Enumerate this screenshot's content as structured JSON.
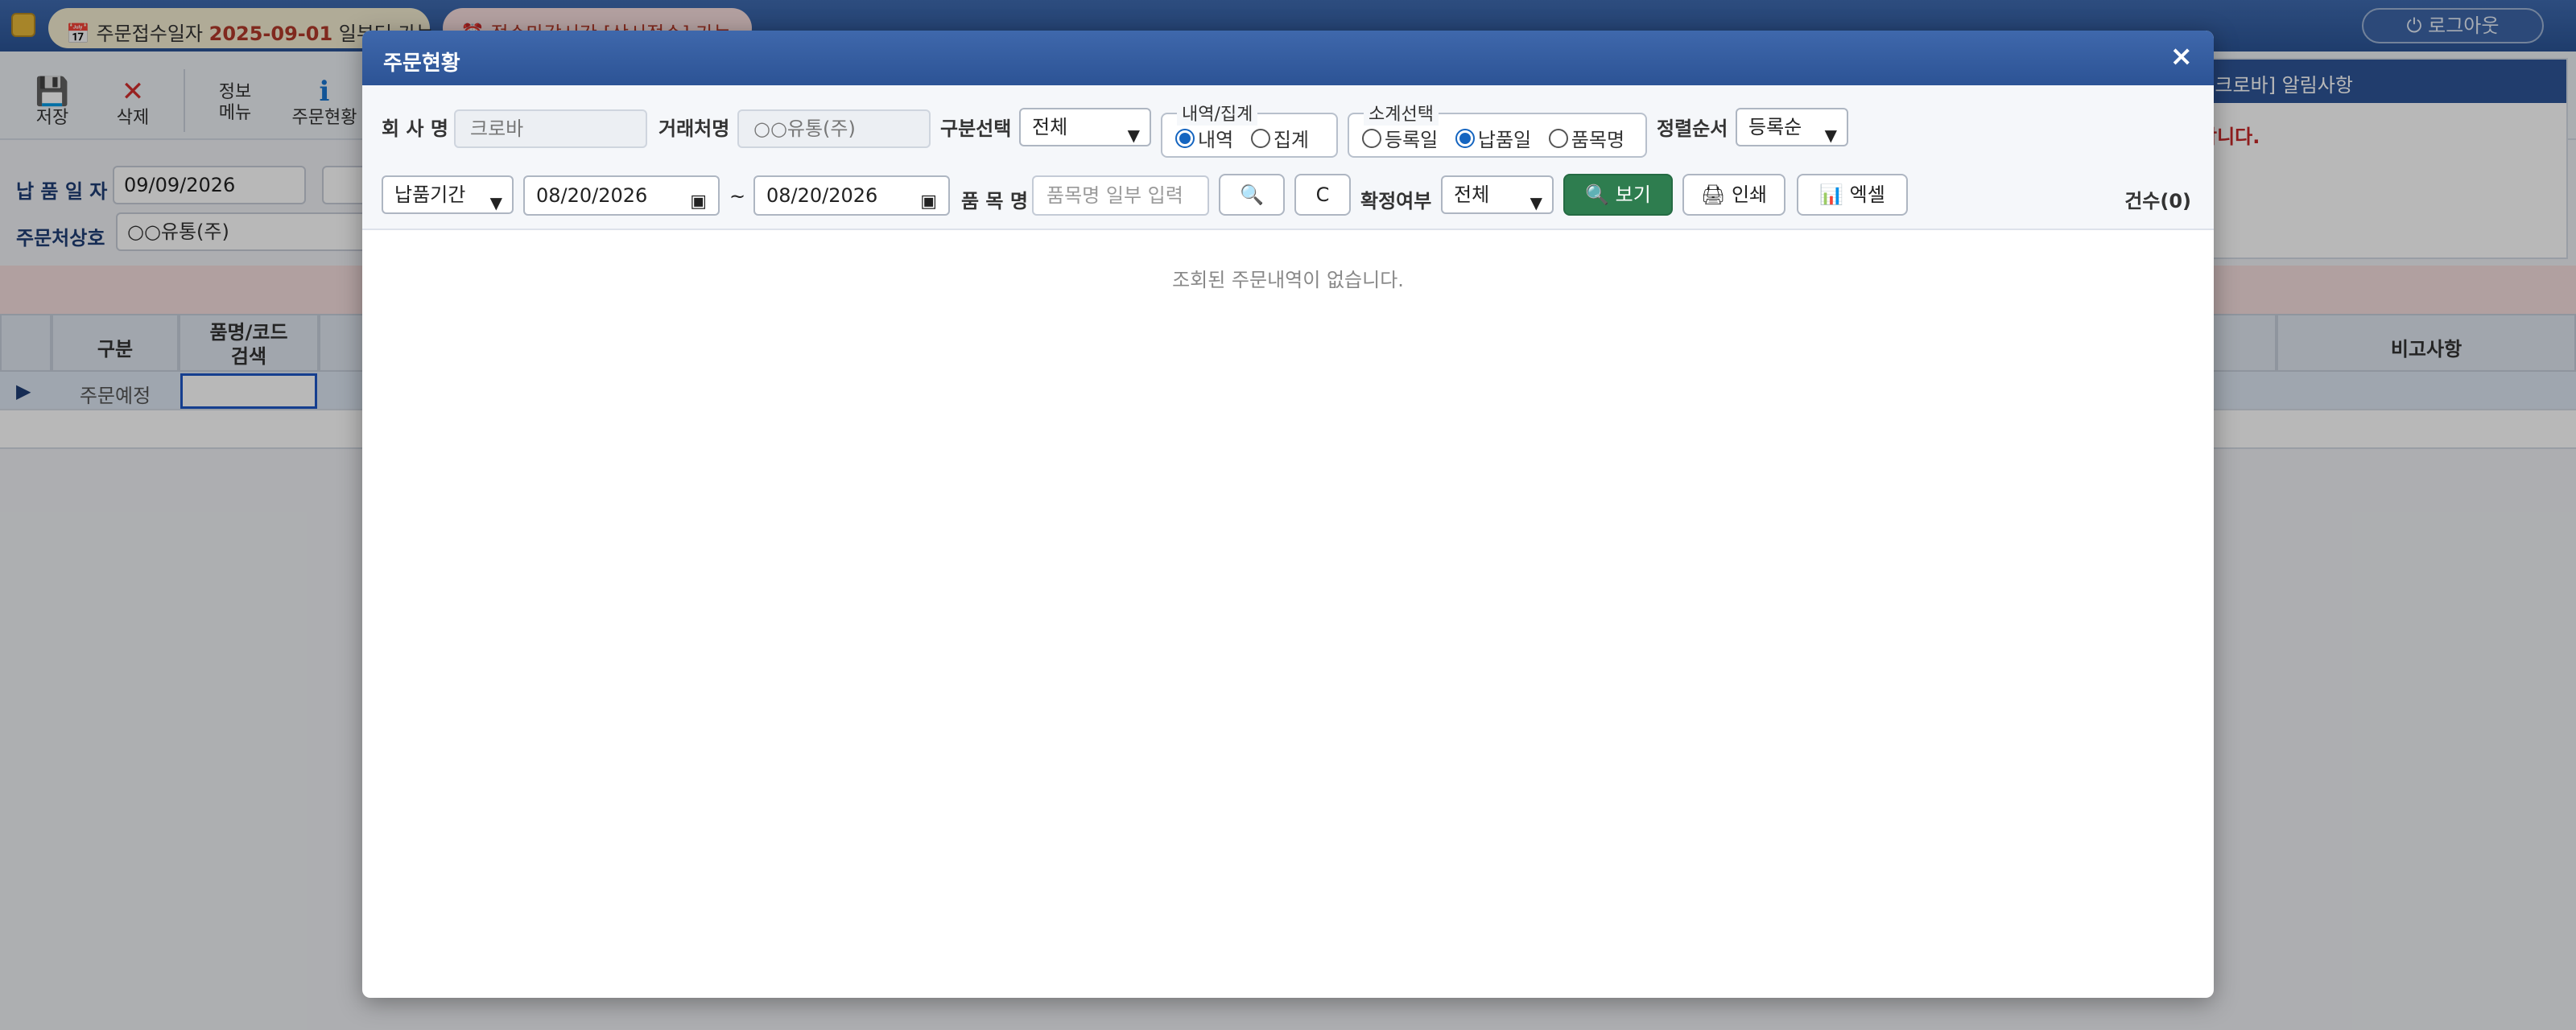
{
  "topbar": {
    "order_notice_prefix": "📅 주문접수일자 ",
    "order_notice_date": "2025-09-01",
    "order_notice_suffix": " 일부터 가능",
    "deadline_notice": "⏰ 접수마감시간 [상시접수] 가능",
    "logout_label": "⏻ 로그아웃"
  },
  "toolbar": {
    "save_label": "저장",
    "delete_label": "삭제",
    "info_label_line1": "정보",
    "info_label_line2": "메뉴",
    "order_status_label": "주문현황"
  },
  "form": {
    "delivery_date_label": "납 품 일 자",
    "delivery_date_value": "09/09/2026",
    "vendor_label": "주문처상호",
    "vendor_value": "○○유통(주)"
  },
  "notice_panel": {
    "title": "[크로바] 알림사항",
    "message": "합니다."
  },
  "grid": {
    "col_type": "구분",
    "col_item_line1": "품명/코드",
    "col_item_line2": "검색",
    "col_remarks": "비고사항",
    "row1_type": "주문예정",
    "row_pointer": "▶"
  },
  "modal": {
    "title": "주문현황",
    "close_label": "×",
    "company_label": "회 사 명",
    "company_value": "크로바",
    "partner_label": "거래처명",
    "partner_value": "○○유통(주)",
    "category_label": "구분선택",
    "category_value": "전체",
    "detail_group_legend": "내역/집계",
    "detail_option": "내역",
    "summary_option": "집계",
    "subtotal_legend": "소계선택",
    "subtotal_reg_date": "등록일",
    "subtotal_delivery_date": "납품일",
    "subtotal_item_name": "품목명",
    "sort_label": "정렬순서",
    "sort_value": "등록순",
    "period_type_value": "납품기간",
    "date_from": "08/20/2026",
    "date_sep": "~",
    "date_to": "08/20/2026",
    "item_label": "품 목 명",
    "item_placeholder": "품목명 일부 입력",
    "search_icon": "🔍",
    "clear_label": "C",
    "confirm_label": "확정여부",
    "confirm_value": "전체",
    "view_label": "🔍 보기",
    "print_label": "🖨 인쇄",
    "excel_label": "📊 엑셀",
    "count_label": "건수(0)",
    "empty_message": "조회된 주문내역이 없습니다."
  }
}
